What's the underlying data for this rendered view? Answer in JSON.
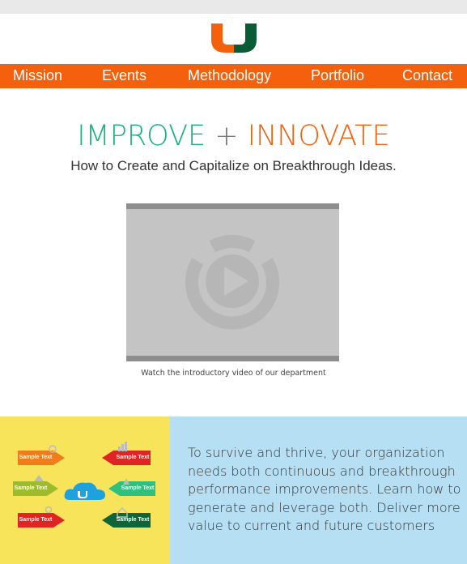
{
  "colors": {
    "brand_orange": "#f4600c",
    "brand_green": "#19b27a",
    "yellow_panel": "#f8e45a",
    "blue_panel": "#b7dff3"
  },
  "logo": {
    "icon": "university-u-logo"
  },
  "nav": {
    "items": [
      "Mission",
      "Events",
      "Methodology",
      "Portfolio",
      "Contact"
    ]
  },
  "hero": {
    "headline_part1": "IMPROVE",
    "headline_plus": "+",
    "headline_part2": "INNOVATE",
    "subheadline": "How to Create and Capitalize on Breakthrough Ideas."
  },
  "video": {
    "icon": "play-icon",
    "caption": "Watch the introductory video of our department"
  },
  "infographic": {
    "hub_icon": "cloud-u-icon",
    "labels": [
      "Sample Text",
      "Sample Text",
      "Sample Text",
      "Sample Text",
      "Sample Text",
      "Sample Text"
    ]
  },
  "body": {
    "paragraph": "To survive and thrive, your organization needs both continuous and breakthrough performance improvements. Learn how to generate and leverage both. Deliver more value to current and future customers"
  }
}
